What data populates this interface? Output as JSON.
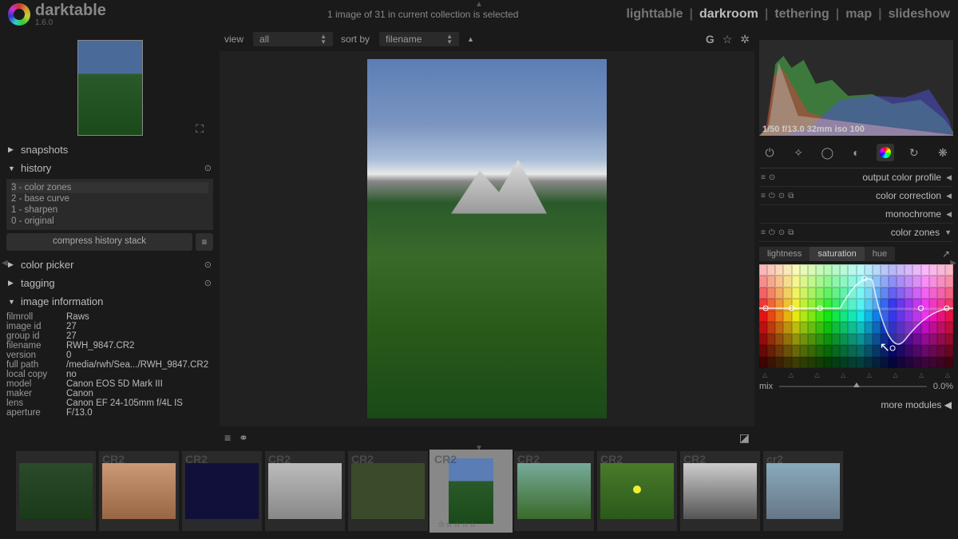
{
  "app": {
    "name": "darktable",
    "version": "1.6.0"
  },
  "status": "1 image of 31 in current collection is selected",
  "nav": {
    "items": [
      "lighttable",
      "darkroom",
      "tethering",
      "map",
      "slideshow"
    ],
    "active": "darkroom"
  },
  "filter": {
    "view_label": "view",
    "view_value": "all",
    "sort_label": "sort by",
    "sort_value": "filename"
  },
  "left": {
    "snapshots": "snapshots",
    "history": {
      "title": "history",
      "items": [
        "3 - color zones",
        "2 - base curve",
        "1 - sharpen",
        "0 - original"
      ],
      "compress": "compress history stack"
    },
    "color_picker": "color picker",
    "tagging": "tagging",
    "image_info": {
      "title": "image information",
      "rows": [
        {
          "k": "filmroll",
          "v": "Raws"
        },
        {
          "k": "image id",
          "v": "27"
        },
        {
          "k": "group id",
          "v": "27"
        },
        {
          "k": "filename",
          "v": "RWH_9847.CR2"
        },
        {
          "k": "version",
          "v": "0"
        },
        {
          "k": "full path",
          "v": "/media/rwh/Sea.../RWH_9847.CR2"
        },
        {
          "k": "local copy",
          "v": "no"
        },
        {
          "k": "model",
          "v": "Canon EOS 5D Mark III"
        },
        {
          "k": "maker",
          "v": "Canon"
        },
        {
          "k": "lens",
          "v": "Canon EF 24-105mm f/4L IS"
        },
        {
          "k": "aperture",
          "v": "F/13.0"
        }
      ]
    }
  },
  "histogram_info": "1/50 f/13.0 32mm iso 100",
  "modules": [
    {
      "name": "output color profile",
      "icons": 2
    },
    {
      "name": "color correction",
      "icons": 4
    },
    {
      "name": "monochrome",
      "icons": 0
    },
    {
      "name": "color zones",
      "icons": 4,
      "expanded": true
    }
  ],
  "color_zones": {
    "tabs": [
      "lightness",
      "saturation",
      "hue"
    ],
    "active_tab": "saturation",
    "mix_label": "mix",
    "mix_value": "0.0%"
  },
  "more_modules": "more modules",
  "toolbar_icons": {
    "g": "G"
  }
}
